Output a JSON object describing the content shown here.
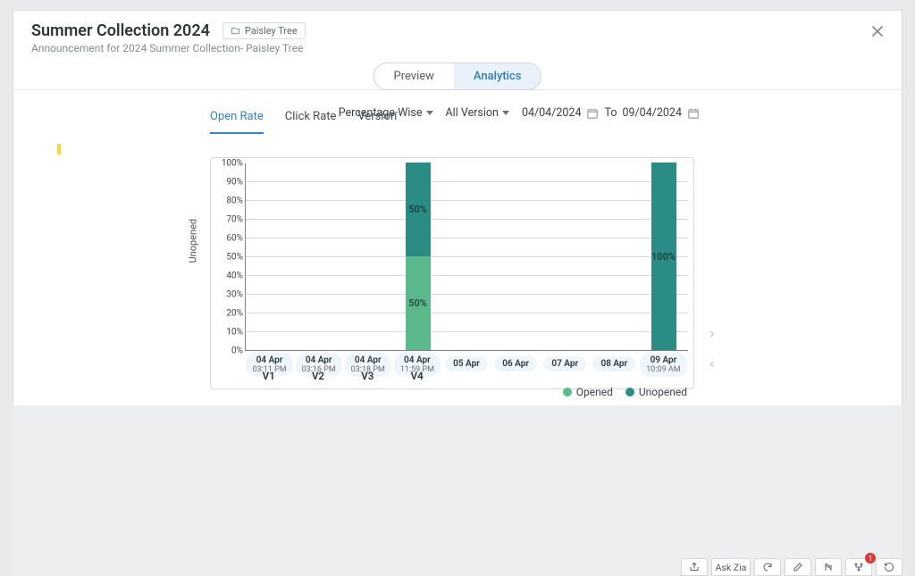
{
  "header": {
    "title": "Summer Collection 2024",
    "folder": "Paisley Tree",
    "subtitle": "Announcement for 2024 Summer Collection- Paisley Tree"
  },
  "tabs": {
    "preview": "Preview",
    "analytics": "Analytics"
  },
  "subtabs": {
    "open": "Open Rate",
    "click": "Click Rate",
    "version": "Version"
  },
  "controls": {
    "mode": "Percentage-Wise",
    "version": "All Version",
    "from": "04/04/2024",
    "to_label": "To",
    "to": "09/04/2024"
  },
  "chart": {
    "ylab": "Unopened",
    "yticks": [
      "0%",
      "10%",
      "20%",
      "30%",
      "40%",
      "50%",
      "60%",
      "70%",
      "80%",
      "90%",
      "100%"
    ]
  },
  "legend": {
    "opened": "Opened",
    "unopened": "Unopened"
  },
  "colors": {
    "opened": "#5BB98B",
    "unopened": "#2B8C86"
  },
  "xaxis": [
    {
      "d": "04 Apr",
      "t": "03:11 PM",
      "v": "V1"
    },
    {
      "d": "04 Apr",
      "t": "03:16 PM",
      "v": "V2"
    },
    {
      "d": "04 Apr",
      "t": "03:18 PM",
      "v": "V3"
    },
    {
      "d": "04 Apr",
      "t": "11:59 PM",
      "v": "V4"
    },
    {
      "d": "05 Apr",
      "t": "",
      "v": ""
    },
    {
      "d": "06 Apr",
      "t": "",
      "v": ""
    },
    {
      "d": "07 Apr",
      "t": "",
      "v": ""
    },
    {
      "d": "08 Apr",
      "t": "",
      "v": ""
    },
    {
      "d": "09 Apr",
      "t": "10:09 AM",
      "v": ""
    }
  ],
  "chart_data": {
    "type": "bar",
    "stacked": true,
    "title": "Open Rate",
    "ylabel": "Unopened",
    "ylim": [
      0,
      100
    ],
    "categories": [
      "04 Apr 03:11 PM",
      "04 Apr 03:16 PM",
      "04 Apr 03:18 PM",
      "04 Apr 11:59 PM",
      "05 Apr",
      "06 Apr",
      "07 Apr",
      "08 Apr",
      "09 Apr 10:09 AM"
    ],
    "version_labels": [
      "V1",
      "V2",
      "V3",
      "V4",
      "",
      "",
      "",
      "",
      ""
    ],
    "series": [
      {
        "name": "Opened",
        "values": [
          0,
          0,
          0,
          50,
          0,
          0,
          0,
          0,
          0
        ]
      },
      {
        "name": "Unopened",
        "values": [
          0,
          0,
          0,
          50,
          0,
          0,
          0,
          0,
          100
        ]
      }
    ],
    "bar_labels": [
      {
        "opened": "",
        "unopened": ""
      },
      {
        "opened": "",
        "unopened": ""
      },
      {
        "opened": "",
        "unopened": ""
      },
      {
        "opened": "50%",
        "unopened": "50%"
      },
      {
        "opened": "",
        "unopened": ""
      },
      {
        "opened": "",
        "unopened": ""
      },
      {
        "opened": "",
        "unopened": ""
      },
      {
        "opened": "",
        "unopened": ""
      },
      {
        "opened": "",
        "unopened": "100%"
      }
    ]
  },
  "toolbar": {
    "ask": "Ask Zia",
    "badge": "1"
  }
}
